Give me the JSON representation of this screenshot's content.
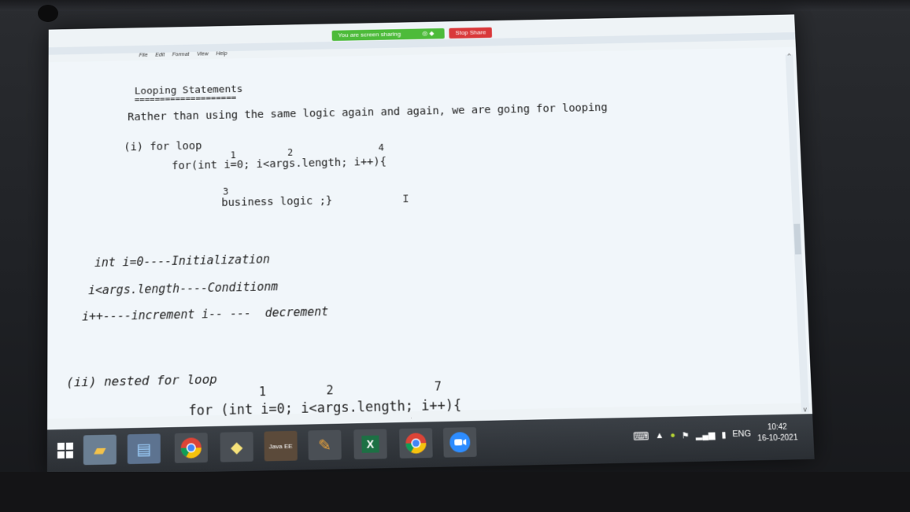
{
  "share_bar": {
    "status_text": "You are screen sharing",
    "stop_label": "Stop Share"
  },
  "menu": [
    "File",
    "Edit",
    "Format",
    "View",
    "Help"
  ],
  "editor": {
    "heading": "Looping Statements",
    "underline": "====================",
    "intro": "Rather than using the same logic again and again, we are going for looping",
    "section1": "(i) for loop",
    "for_line": "for(int i=0; i<args.length; i++){",
    "sup_1": "1",
    "sup_2": "2",
    "sup_4": "4",
    "sup_3": "3",
    "body_line": "business logic ;}",
    "init_line": "int i=0----Initialization",
    "cond_line": "i<args.length----Conditionm",
    "incr_line": "i++----increment i-- ---  decrement",
    "section2": "(ii) nested for loop",
    "nested_sup_1": "1",
    "nested_sup_2": "2",
    "nested_sup_7": "7",
    "nested_for_line": "for (int i=0; i<args.length; i++){"
  },
  "taskbar": {
    "icons": [
      "windows-start-icon",
      "file-explorer-icon",
      "notepad-icon",
      "chrome-icon",
      "sticky-notes-icon",
      "java-ee-icon",
      "paint-icon",
      "excel-icon",
      "chrome-icon",
      "zoom-icon"
    ],
    "java_label": "Java EE",
    "language": "ENG",
    "time": "10:42",
    "date": "16-10-2021"
  },
  "colors": {
    "share_green": "#4dbb3a",
    "stop_red": "#d9383a",
    "taskbar": "#2f3338",
    "editor_bg": "#f1f6fa"
  }
}
